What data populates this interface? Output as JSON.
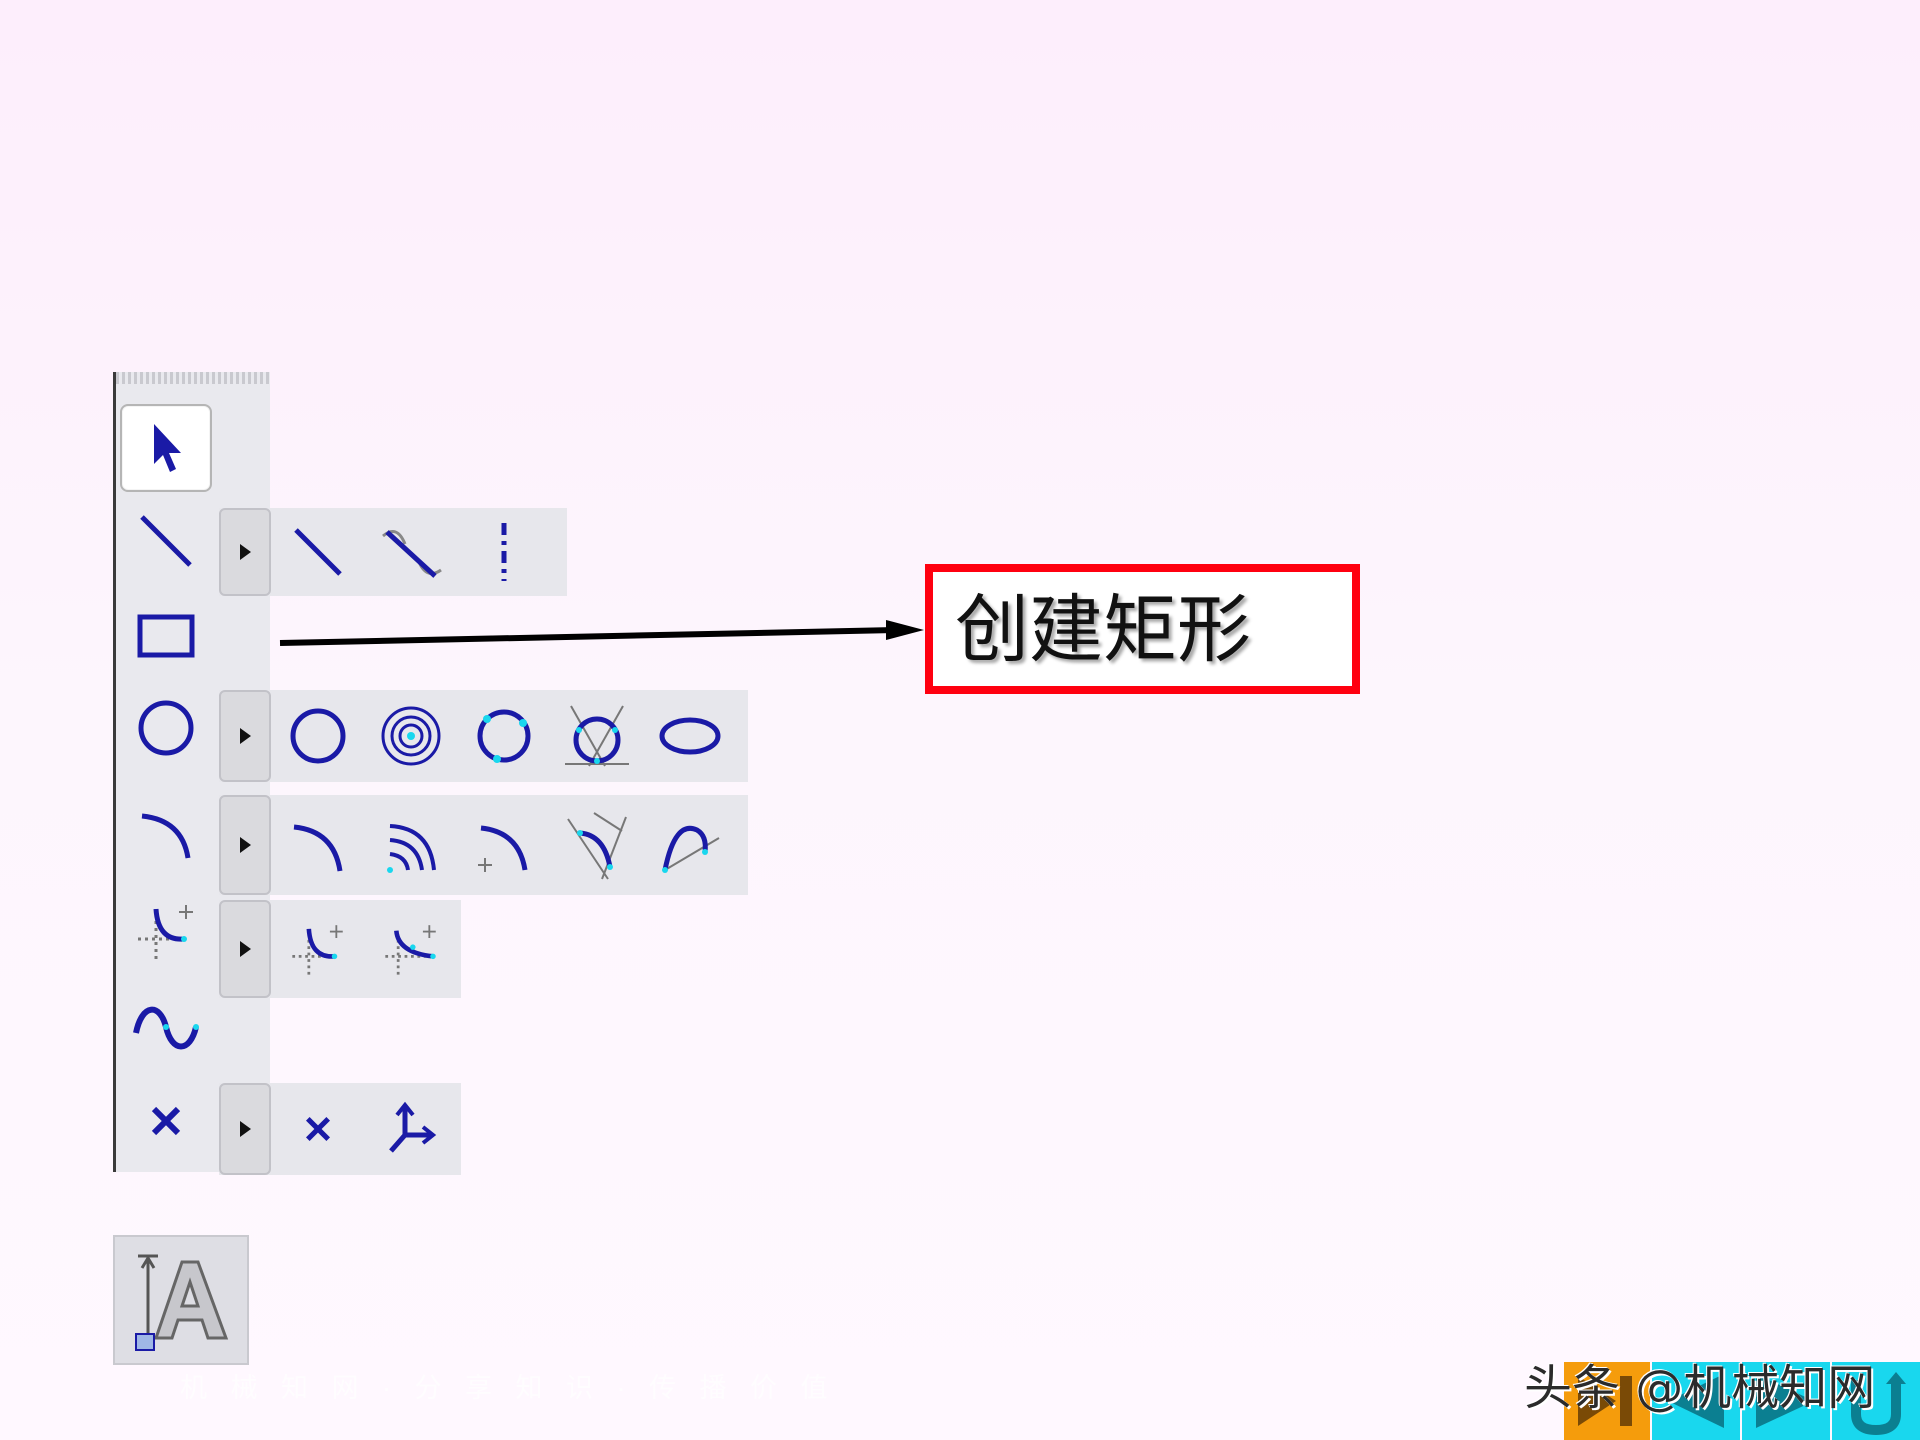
{
  "callout": {
    "text": "创建矩形"
  },
  "toolbar": {
    "tools": [
      {
        "name": "select",
        "icon": "pointer-arrow-icon",
        "selected": true
      },
      {
        "name": "line",
        "icon": "line-icon"
      },
      {
        "name": "rectangle",
        "icon": "rectangle-icon"
      },
      {
        "name": "circle",
        "icon": "circle-icon"
      },
      {
        "name": "arc",
        "icon": "arc-icon"
      },
      {
        "name": "fillet",
        "icon": "fillet-icon"
      },
      {
        "name": "spline",
        "icon": "spline-icon"
      },
      {
        "name": "point",
        "icon": "point-icon"
      }
    ],
    "flyouts": {
      "line": [
        "line-icon",
        "tangent-line-icon",
        "centerline-icon"
      ],
      "circle": [
        "circle-icon",
        "concentric-circle-icon",
        "three-point-circle-icon",
        "tangent-circle-icon",
        "ellipse-icon"
      ],
      "arc": [
        "arc-icon",
        "concentric-arc-icon",
        "three-point-arc-icon",
        "tangent-arc-icon",
        "conic-arc-icon"
      ],
      "fillet": [
        "circular-fillet-icon",
        "elliptical-fillet-icon"
      ],
      "point": [
        "point-icon",
        "coordinate-system-icon"
      ]
    },
    "text_tool": {
      "icon": "text-tool-icon"
    }
  },
  "watermark": {
    "slogan": "机 械 知 网 · 分 享 知 识 · 传 播 价 值",
    "brand": "头条 @机械知网"
  },
  "colors": {
    "icon_blue": "#1a1aa6",
    "icon_cyan": "#19d7ee",
    "callout_red": "#ff0010",
    "nav_orange": "#f59c0c",
    "nav_cyan": "#19d7ee"
  }
}
